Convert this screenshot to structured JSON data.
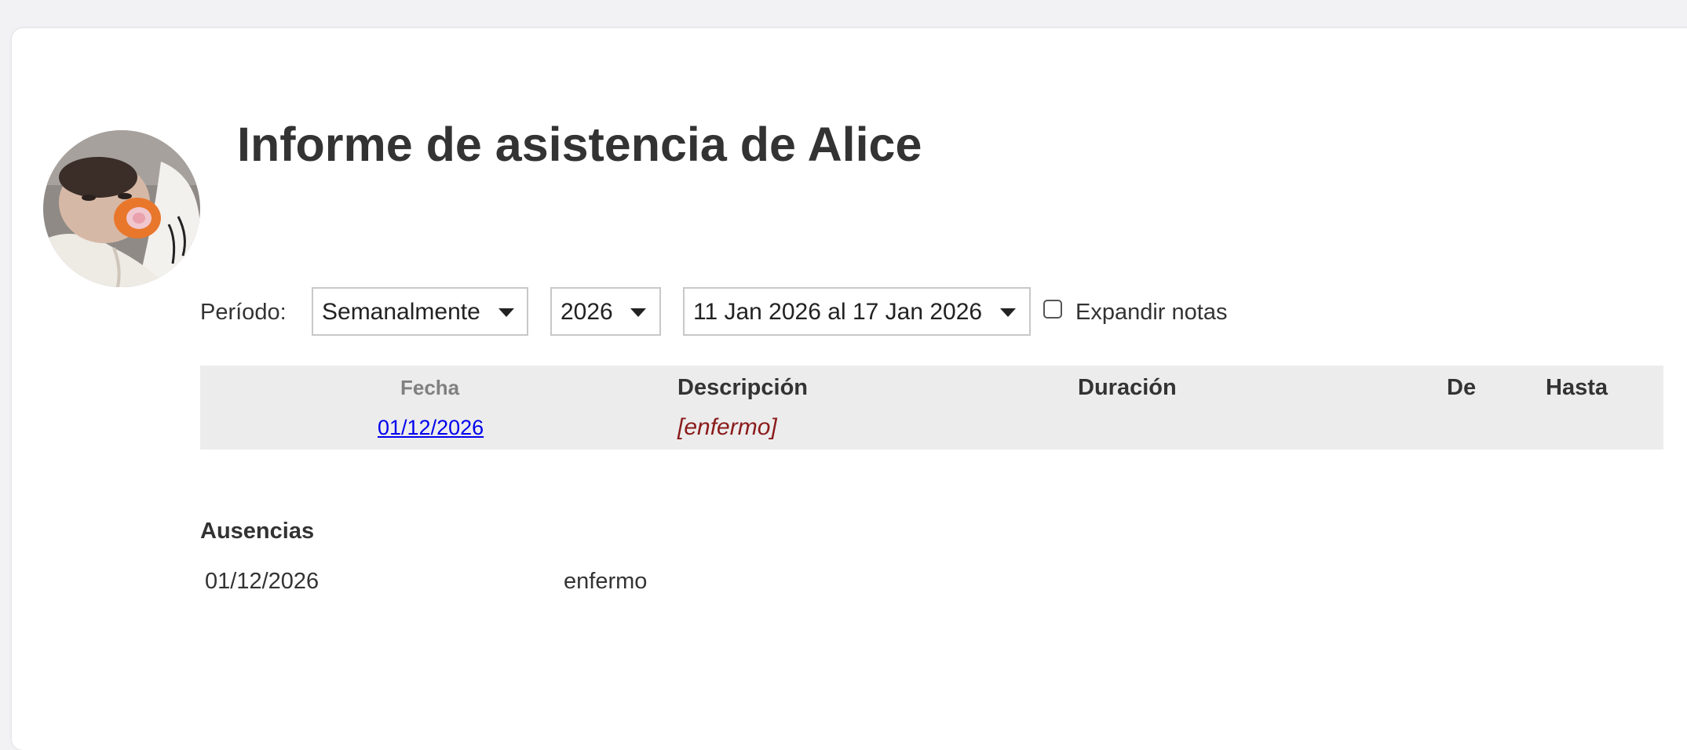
{
  "page": {
    "title": "Informe de asistencia de Alice"
  },
  "controls": {
    "period_label": "Período:",
    "period_value": "Semanalmente",
    "year_value": "2026",
    "range_value": "11 Jan 2026 al 17 Jan 2026",
    "expand_notes_label": "Expandir notas",
    "expand_notes_checked": false
  },
  "table": {
    "headers": {
      "fecha": "Fecha",
      "descripcion": "Descripción",
      "duracion": "Duración",
      "de": "De",
      "hasta": "Hasta"
    },
    "rows": [
      {
        "fecha": "01/12/2026",
        "descripcion": "[enfermo]",
        "duracion": "",
        "de": "",
        "hasta": ""
      }
    ]
  },
  "absences": {
    "title": "Ausencias",
    "items": [
      {
        "date": "01/12/2026",
        "reason": "enfermo"
      }
    ]
  },
  "colors": {
    "background": "#f2f2f5",
    "card": "#ffffff",
    "table_bg": "#ececec",
    "link": "#0000ee",
    "note": "#8b1a1a",
    "text": "#333333"
  }
}
